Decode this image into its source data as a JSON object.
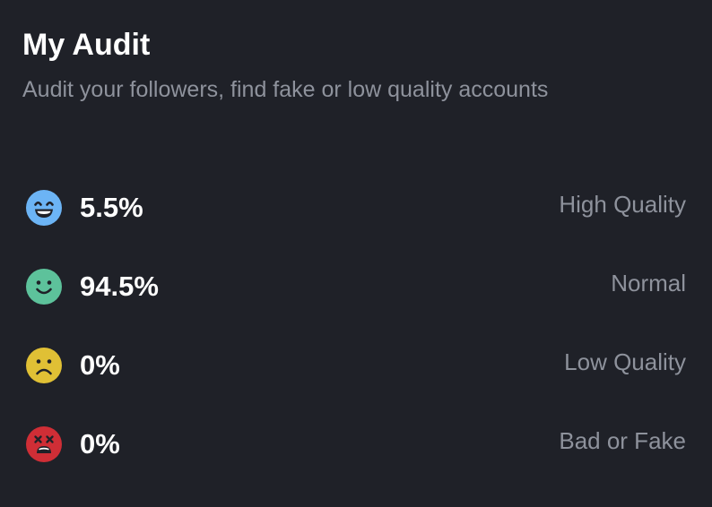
{
  "header": {
    "title": "My Audit",
    "subtitle": "Audit your followers, find fake or low quality accounts"
  },
  "rows": [
    {
      "icon": "grinning-face-icon",
      "color": "#6cb4f5",
      "percent": "5.5%",
      "label": "High Quality"
    },
    {
      "icon": "smiling-face-icon",
      "color": "#5dc29b",
      "percent": "94.5%",
      "label": "Normal"
    },
    {
      "icon": "frowning-face-icon",
      "color": "#e0c035",
      "percent": "0%",
      "label": "Low Quality"
    },
    {
      "icon": "dizzy-face-icon",
      "color": "#cf2e36",
      "percent": "0%",
      "label": "Bad or Fake"
    }
  ],
  "colors": {
    "background": "#1f2128",
    "text_primary": "#ffffff",
    "text_muted": "#8e929c"
  }
}
